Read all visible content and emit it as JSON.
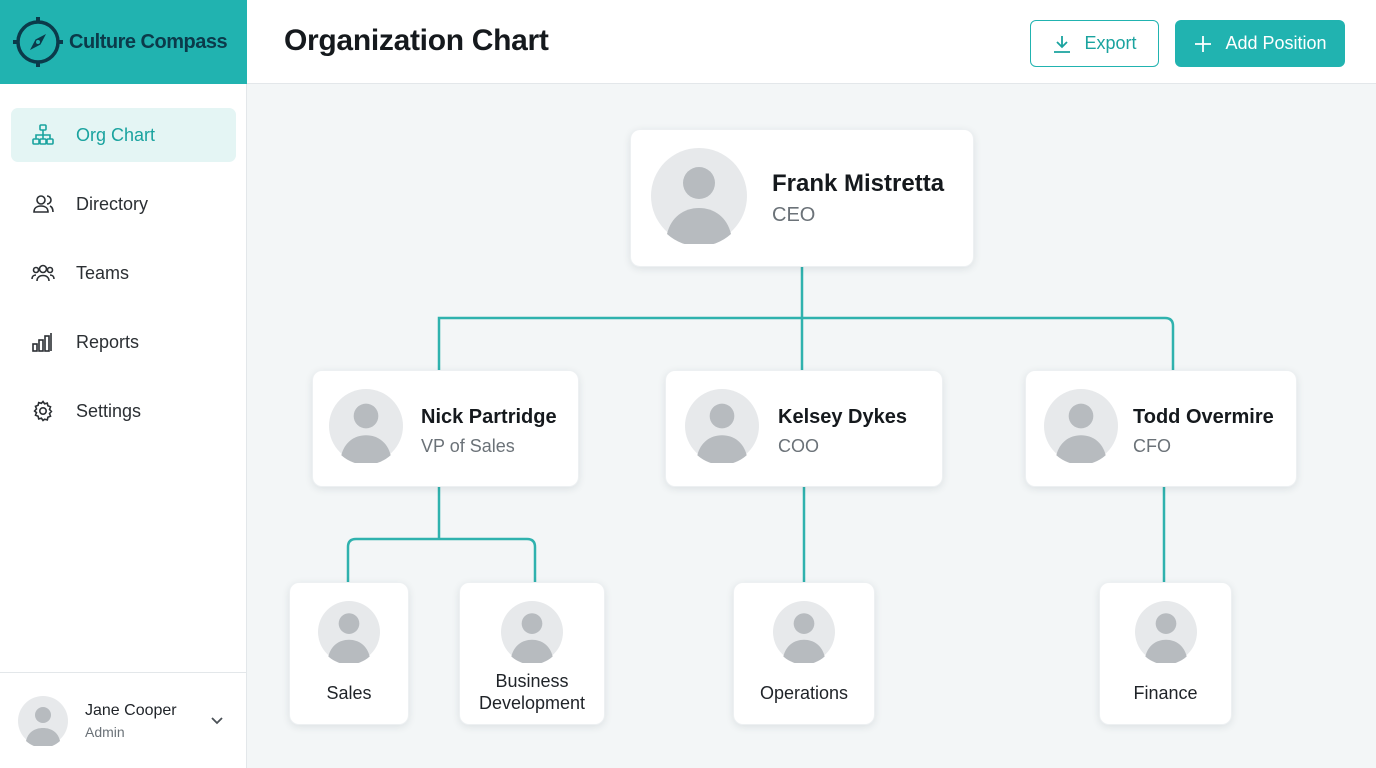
{
  "app": {
    "brand_name": "Culture Compass",
    "accent_color": "#21b3b0"
  },
  "sidebar": {
    "items": [
      {
        "label": "Org Chart",
        "icon": "org-chart-icon",
        "active": true
      },
      {
        "label": "Directory",
        "icon": "user-icon",
        "active": false
      },
      {
        "label": "Teams",
        "icon": "users-icon",
        "active": false
      },
      {
        "label": "Reports",
        "icon": "bar-chart-icon",
        "active": false
      },
      {
        "label": "Settings",
        "icon": "gear-icon",
        "active": false
      }
    ],
    "user": {
      "name": "Jane Cooper",
      "role": "Admin"
    }
  },
  "header": {
    "title": "Organization Chart",
    "export_label": "Export",
    "add_position_label": "Add Position"
  },
  "org": {
    "ceo": {
      "name": "Frank Mistretta",
      "title": "CEO"
    },
    "executives": [
      {
        "name": "Nick Partridge",
        "title": "VP of Sales"
      },
      {
        "name": "Kelsey Dykes",
        "title": "COO"
      },
      {
        "name": "Todd Overmire",
        "title": "CFO"
      }
    ],
    "departments": [
      {
        "name": "Sales",
        "reports_to": "Nick Partridge"
      },
      {
        "name": "Business Development",
        "reports_to": "Nick Partridge"
      },
      {
        "name": "Operations",
        "reports_to": "Kelsey Dykes"
      },
      {
        "name": "Finance",
        "reports_to": "Todd Overmire"
      }
    ]
  }
}
